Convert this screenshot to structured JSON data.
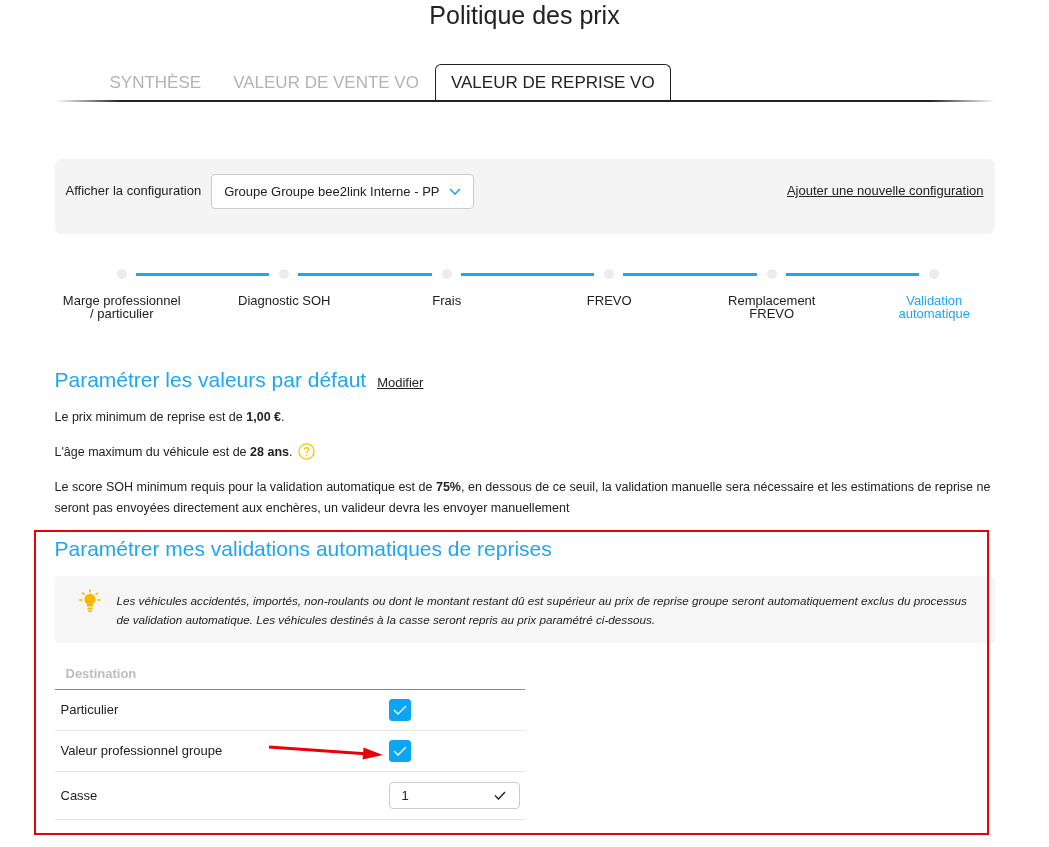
{
  "page": {
    "title": "Politique des prix"
  },
  "tabs": [
    {
      "label": "SYNTHÈSE",
      "selected": false
    },
    {
      "label": "VALEUR DE VENTE VO",
      "selected": false
    },
    {
      "label": "VALEUR DE REPRISE VO",
      "selected": true
    }
  ],
  "config": {
    "label": "Afficher la configuration",
    "selected_value": "Groupe Groupe bee2link Interne - PP",
    "link": "Ajouter une nouvelle configuration"
  },
  "steps": [
    {
      "label": "Marge professionnel\n/ particulier",
      "selected": false
    },
    {
      "label": "Diagnostic SOH",
      "selected": false
    },
    {
      "label": "Frais",
      "selected": false
    },
    {
      "label": "FREVO",
      "selected": false
    },
    {
      "label": "Remplacement\nFREVO",
      "selected": false
    },
    {
      "label": "Validation\nautomatique",
      "selected": true
    }
  ],
  "defaults": {
    "title": "Paramétrer les valeurs par défaut",
    "action": "Modifier",
    "lines": [
      {
        "text": "Le prix minimum de reprise est de **1,00 €**.",
        "help": false
      },
      {
        "text": "L'âge maximum du véhicule est de **28 ans**.",
        "help": true
      },
      {
        "text": "Le score SOH minimum requis pour la validation automatique est de **75%**, en dessous de ce seuil, la validation manuelle sera nécessaire et les estimations de reprise ne seront pas envoyées directement aux enchères, un valideur devra les envoyer manuellement",
        "help": false
      }
    ]
  },
  "auto_validation": {
    "title": "Paramétrer mes validations automatiques de reprises",
    "highlighted": true,
    "info": "Les véhicules accidentés, importés, non-roulants ou dont le montant restant dû est supérieur au prix de reprise groupe seront automatiquement exclus du processus de validation automatique. Les véhicules destinés à la casse seront repris au prix paramétré ci-dessous.",
    "table": {
      "columns": [
        "Destination"
      ],
      "rows": [
        {
          "label": "Particulier",
          "kind": "checkbox",
          "checked": true,
          "arrow": false
        },
        {
          "label": "Valeur professionnel groupe",
          "kind": "checkbox",
          "checked": true,
          "arrow": true
        },
        {
          "label": "Casse",
          "kind": "input",
          "value": "1",
          "arrow": false
        }
      ]
    }
  }
}
